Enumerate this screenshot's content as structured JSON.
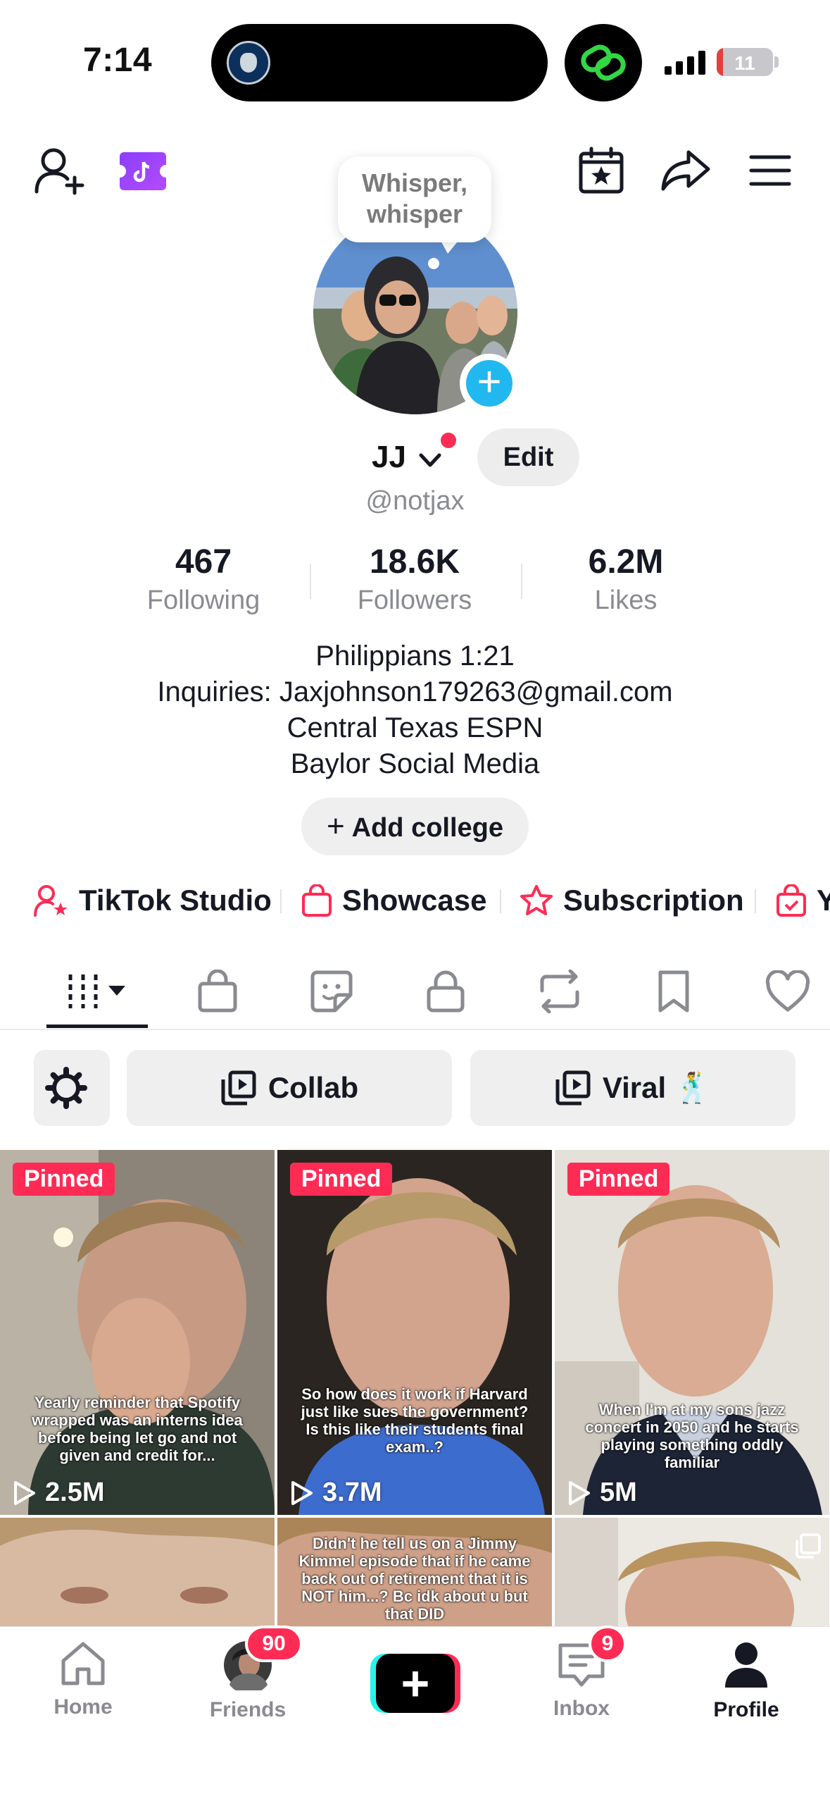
{
  "status_bar": {
    "time": "7:14",
    "battery_level": "11",
    "battery_fraction": 0.11,
    "battery_color": "#e53e3e"
  },
  "top_bar": {
    "icons": [
      "add-friend-icon",
      "tiktok-coin-icon",
      "calendar-star-icon",
      "share-icon",
      "menu-icon"
    ]
  },
  "profile": {
    "note_bubble": "Whisper, whisper",
    "display_name": "JJ",
    "edit_label": "Edit",
    "handle": "@notjax",
    "stats": [
      {
        "value": "467",
        "label": "Following"
      },
      {
        "value": "18.6K",
        "label": "Followers"
      },
      {
        "value": "6.2M",
        "label": "Likes"
      }
    ],
    "bio": [
      "Philippians 1:21",
      "Inquiries: Jaxjohnson179263@gmail.com",
      "Central Texas ESPN",
      "Baylor Social Media"
    ],
    "add_college_label": "Add college"
  },
  "tools": [
    {
      "label": "TikTok Studio",
      "icon": "person-star-icon"
    },
    {
      "label": "Showcase",
      "icon": "shopping-bag-icon"
    },
    {
      "label": "Subscription",
      "icon": "star-badge-icon"
    },
    {
      "label": "Y",
      "icon": "shopping-bag-check-icon"
    }
  ],
  "content_tabs": [
    "videos-grid-icon",
    "shop-bag-icon",
    "sticker-icon",
    "lock-icon",
    "repost-icon",
    "bookmark-icon",
    "heart-icon"
  ],
  "filters": {
    "settings_icon": "gear-icon",
    "chips": [
      {
        "label": "Collab",
        "icon": "playlist-icon"
      },
      {
        "label": "Viral 🕺",
        "icon": "playlist-icon"
      }
    ]
  },
  "videos": [
    {
      "pinned": "Pinned",
      "caption": "Yearly reminder that Spotify wrapped was an interns idea before being let go and not given and credit for...",
      "views": "2.5M"
    },
    {
      "pinned": "Pinned",
      "caption": "So how does it work if Harvard just like sues the government? Is this like their students final exam..?",
      "views": "3.7M"
    },
    {
      "pinned": "Pinned",
      "caption": "When I'm at my sons jazz concert in 2050 and he starts playing something oddly familiar",
      "views": "5M"
    },
    {
      "pinned": "",
      "caption": "",
      "views": ""
    },
    {
      "pinned": "",
      "caption": "Didn't he tell us on a Jimmy Kimmel episode that if he came back out of retirement that it is NOT him...? Bc idk about u but that DID",
      "views": ""
    },
    {
      "pinned": "",
      "caption": "",
      "views": ""
    }
  ],
  "bottom_nav": {
    "items": [
      {
        "label": "Home",
        "icon": "home-icon"
      },
      {
        "label": "Friends",
        "icon": "friend-avatar",
        "badge": "90"
      },
      {
        "label": "",
        "icon": "create-plus-icon"
      },
      {
        "label": "Inbox",
        "icon": "inbox-icon",
        "badge": "9"
      },
      {
        "label": "Profile",
        "icon": "profile-icon"
      }
    ]
  },
  "colors": {
    "brand_red": "#fe2c55",
    "brand_cyan": "#25f4ee",
    "muted_text": "#8a8b91"
  }
}
